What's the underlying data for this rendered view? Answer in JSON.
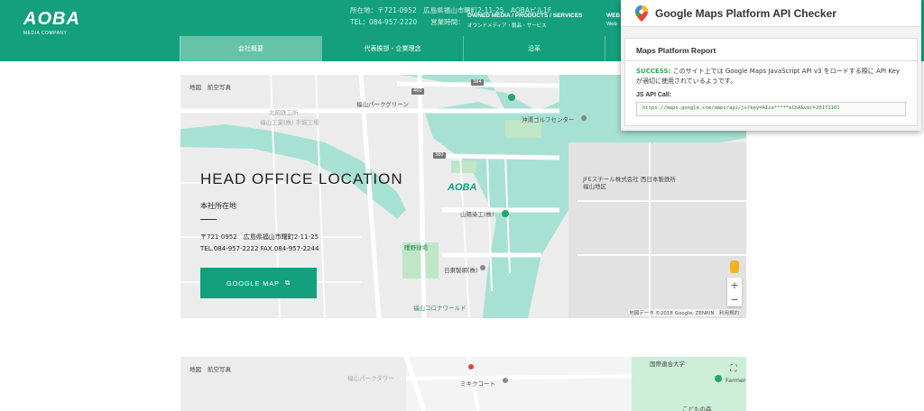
{
  "header": {
    "logo": "AOBA",
    "logo_sub": "MEDIA COMPANY",
    "info_line1": "所在地：〒721-0952　広島県福山市曙町2-11-25　AOBAビル1F",
    "info_line2": "TEL：084-957-2220　　営業時間：",
    "nav1_en": "OWNED MEDIA / PRODUCTS / SERVICES",
    "nav1_jp": "オウンドメディア・製品・サービス",
    "nav2_en": "WEB",
    "nav2_jp": "Web"
  },
  "subnav": {
    "tabs": [
      {
        "label": "会社概要",
        "active": true
      },
      {
        "label": "代表挨拶・企業理念",
        "active": false
      },
      {
        "label": "沿革",
        "active": false
      },
      {
        "label": "",
        "active": false
      },
      {
        "label": "",
        "active": false
      }
    ]
  },
  "map": {
    "type_map": "地図",
    "type_satellite": "航空写真",
    "labels": {
      "kitaoka": "北岡鉄工所",
      "fukuyama_kogyo": "福山工業(株) 手城工場",
      "park_green": "福山パークグリーン",
      "okiura_golf": "沖湯ゴルフセンター",
      "jfe": "JFEスチール株式会社 西日本製鉄所 福山地区",
      "yamaoka": "山陽染工(株)",
      "ball_park": "曙野球場",
      "nikko": "日東製網(株)",
      "corona": "福山コロナワールド",
      "route_4": "460",
      "route_5": "380",
      "route_6": "384"
    },
    "logo_marker": "AOBA",
    "copyright": "地図データ ©2018 Google, ZENRIN　利用規約"
  },
  "office": {
    "title": "HEAD OFFICE LOCATION",
    "subtitle": "本社所在地",
    "address": "〒721-0952　広島県福山市曙町2-11-25",
    "tel": "TEL.084-957-2222 FAX.084-957-2244",
    "button": "GOOGLE MAP"
  },
  "map2": {
    "type_map": "地図",
    "type_satellite": "航空写真",
    "labels": {
      "park_tower": "福山パークタワー",
      "mitsugi": "ミキクコート",
      "university": "国際連合大学",
      "farmer": "Farmer",
      "kodomo": "こどもの森"
    }
  },
  "extension": {
    "title": "Google Maps Platform API Checker",
    "report_title": "Maps Platform Report",
    "success_label": "SUCCESS:",
    "message": "このサイト上では Google Maps JavaScript API v3 をロードする際に API Keyが適切に使用されているようです。",
    "call_label": "JS API Call:",
    "call_url": "https://maps.google.com/maps/api/js?key=AIza*****eChA&ver=20171101"
  },
  "colors": {
    "brand_green": "#14a07c",
    "water": "#a7e1d4",
    "success": "#2fa84f"
  }
}
